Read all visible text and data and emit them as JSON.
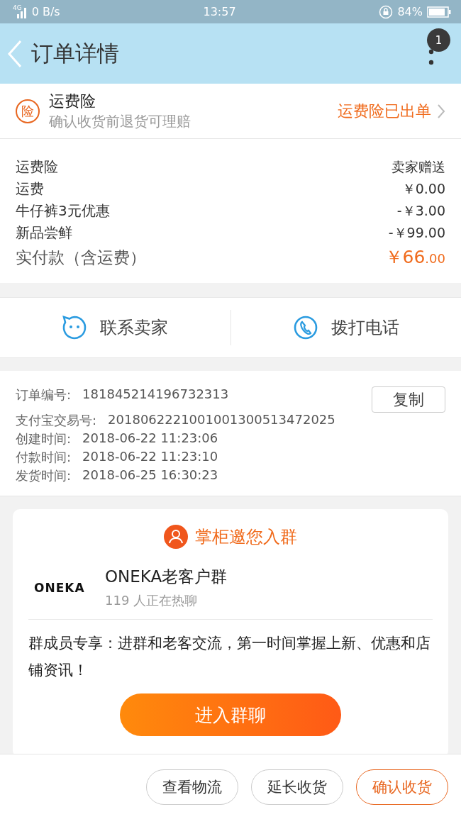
{
  "status_bar": {
    "network": "4G",
    "speed": "0 B/s",
    "time": "13:57",
    "battery": "84%"
  },
  "header": {
    "title": "订单详情",
    "badge": "1"
  },
  "insurance": {
    "icon_char": "险",
    "title": "运费险",
    "subtitle": "确认收货前退货可理赔",
    "status": "运费险已出单"
  },
  "fees": [
    {
      "label": "运费险",
      "value": "卖家赠送"
    },
    {
      "label": "运费",
      "value": "￥0.00"
    },
    {
      "label": "牛仔裤3元优惠",
      "value": "-￥3.00"
    },
    {
      "label": "新品尝鲜",
      "value": "-￥99.00"
    }
  ],
  "total": {
    "label": "实付款（含运费）",
    "amount": "￥66",
    "cents": ".00"
  },
  "contact": [
    {
      "kind": "chat",
      "label": "联系卖家"
    },
    {
      "kind": "phone",
      "label": "拨打电话"
    }
  ],
  "order_info": {
    "copy_button": "复制",
    "rows": [
      {
        "label": "订单编号:",
        "value": "181845214196732313"
      },
      {
        "label": "支付宝交易号:",
        "value": "2018062221001001300513472025"
      },
      {
        "label": "创建时间:",
        "value": "2018-06-22 11:23:06"
      },
      {
        "label": "付款时间:",
        "value": "2018-06-22 11:23:10"
      },
      {
        "label": "发货时间:",
        "value": "2018-06-25 16:30:23"
      }
    ]
  },
  "group_card": {
    "title": "掌柜邀您入群",
    "logo": "ONEKA",
    "name": "ONEKA老客户群",
    "members": "119 人正在热聊",
    "description": "群成员专享：进群和老客交流，第一时间掌握上新、优惠和店铺资讯！",
    "button": "进入群聊"
  },
  "bottom_buttons": [
    {
      "label": "查看物流",
      "primary": false
    },
    {
      "label": "延长收货",
      "primary": false
    },
    {
      "label": "确认收货",
      "primary": true
    }
  ]
}
